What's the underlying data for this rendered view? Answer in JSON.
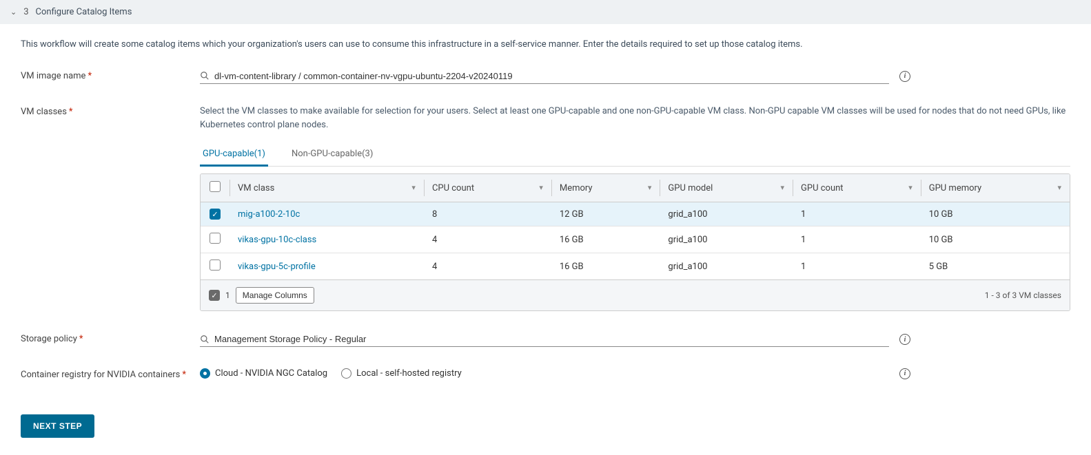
{
  "section": {
    "number": "3",
    "title": "Configure Catalog Items"
  },
  "intro": "This workflow will create some catalog items which your organization's users can use to consume this infrastructure in a self-service manner. Enter the details required to set up those catalog items.",
  "labels": {
    "vm_image_name": "VM image name",
    "vm_classes": "VM classes",
    "storage_policy": "Storage policy",
    "container_registry": "Container registry for NVIDIA containers"
  },
  "vm_image_value": "dl-vm-content-library / common-container-nv-vgpu-ubuntu-2204-v20240119",
  "vm_classes_helper": "Select the VM classes to make available for selection for your users. Select at least one GPU-capable and one non-GPU-capable VM class. Non-GPU capable VM classes will be used for nodes that do not need GPUs, like Kubernetes control plane nodes.",
  "tabs": {
    "gpu": "GPU-capable(1)",
    "non_gpu": "Non-GPU-capable(3)"
  },
  "table": {
    "headers": {
      "vm_class": "VM class",
      "cpu_count": "CPU count",
      "memory": "Memory",
      "gpu_model": "GPU model",
      "gpu_count": "GPU count",
      "gpu_memory": "GPU memory"
    },
    "rows": [
      {
        "selected": true,
        "vm_class": "mig-a100-2-10c",
        "cpu_count": "8",
        "memory": "12 GB",
        "gpu_model": "grid_a100",
        "gpu_count": "1",
        "gpu_memory": "10 GB"
      },
      {
        "selected": false,
        "vm_class": "vikas-gpu-10c-class",
        "cpu_count": "4",
        "memory": "16 GB",
        "gpu_model": "grid_a100",
        "gpu_count": "1",
        "gpu_memory": "10 GB"
      },
      {
        "selected": false,
        "vm_class": "vikas-gpu-5c-profile",
        "cpu_count": "4",
        "memory": "16 GB",
        "gpu_model": "grid_a100",
        "gpu_count": "1",
        "gpu_memory": "5 GB"
      }
    ],
    "footer": {
      "selected_count": "1",
      "manage": "Manage Columns",
      "pagination": "1 - 3 of 3 VM classes"
    }
  },
  "storage_policy_value": "Management Storage Policy - Regular",
  "registry": {
    "cloud": "Cloud - NVIDIA NGC Catalog",
    "local": "Local - self-hosted registry",
    "selected": "cloud"
  },
  "next_button": "NEXT STEP"
}
